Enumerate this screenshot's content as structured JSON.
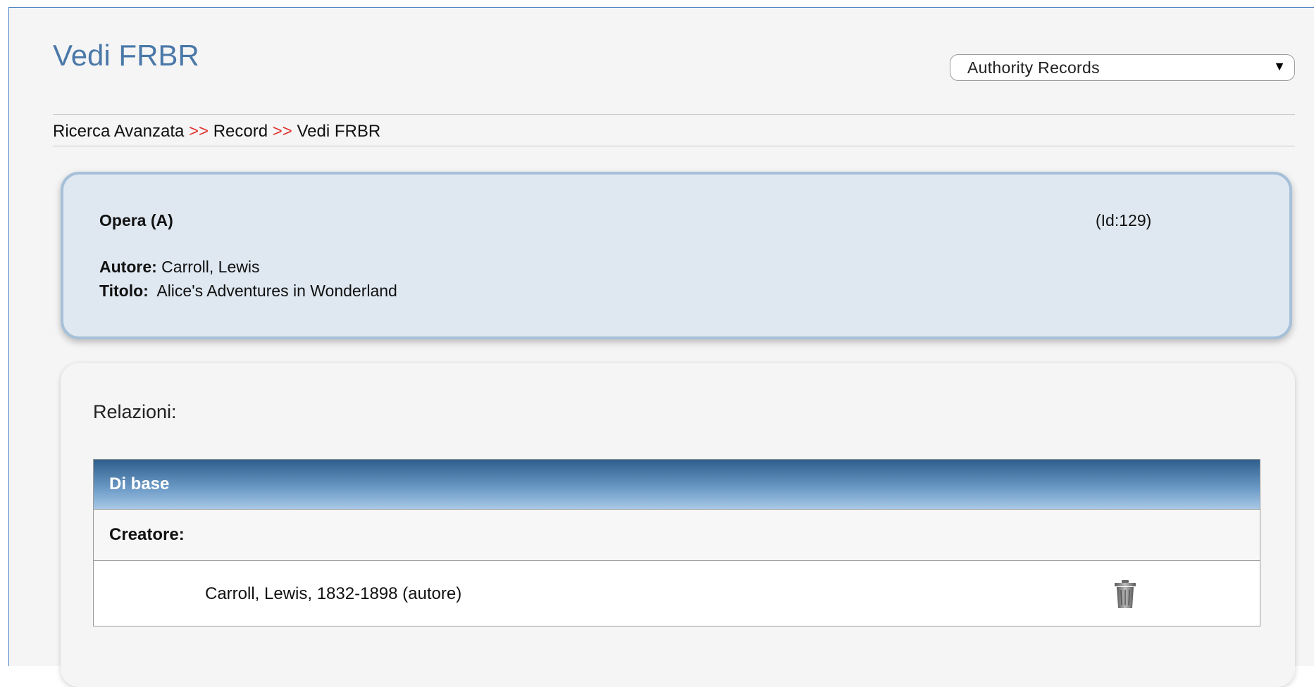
{
  "page": {
    "title": "Vedi FRBR"
  },
  "record_type_select": {
    "selected": "Authority Records",
    "arrow": "▼"
  },
  "breadcrumb": {
    "items": [
      "Ricerca Avanzata",
      "Record",
      "Vedi FRBR"
    ],
    "separator": " >> "
  },
  "record": {
    "type_label": "Opera (A)",
    "id_label": "(Id:129)",
    "author_label": "Autore:",
    "author_value": " Carroll, Lewis",
    "title_label": "Titolo:",
    "title_value": "  Alice's Adventures in Wonderland"
  },
  "relations": {
    "heading": "Relazioni:",
    "section_header": "Di base",
    "group_label": "Creatore:",
    "entries": [
      {
        "text": "Carroll, Lewis, 1832-1898 (autore)",
        "action_icon": "trash-icon"
      }
    ]
  },
  "colors": {
    "title": "#4a78a8",
    "separator": "#e0322e",
    "record_card_bg": "#dfe8f1",
    "record_card_border": "#a7c0d9",
    "table_header_top": "#2f5e8c",
    "table_header_bottom": "#a8c8e6"
  }
}
